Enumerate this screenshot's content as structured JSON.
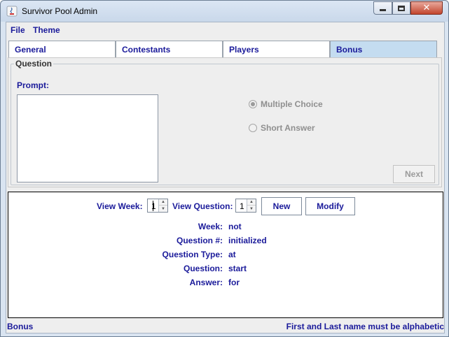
{
  "window": {
    "title": "Survivor Pool Admin"
  },
  "menu": {
    "file": "File",
    "theme": "Theme"
  },
  "tabs": [
    {
      "label": "General"
    },
    {
      "label": "Contestants"
    },
    {
      "label": "Players"
    },
    {
      "label": "Bonus"
    }
  ],
  "question_group": {
    "title": "Question",
    "prompt_label": "Prompt:",
    "radio_multiple_choice": "Multiple Choice",
    "radio_short_answer": "Short Answer",
    "next_button": "Next"
  },
  "viewer": {
    "view_week_label": "View Week:",
    "view_week_value": "1",
    "view_question_label": "View Question:",
    "view_question_value": "1",
    "new_button": "New",
    "modify_button": "Modify",
    "fields": [
      {
        "label": "Week:",
        "value": "not"
      },
      {
        "label": "Question #:",
        "value": "initialized"
      },
      {
        "label": "Question Type:",
        "value": "at"
      },
      {
        "label": "Question:",
        "value": "start"
      },
      {
        "label": "Answer:",
        "value": "for"
      }
    ]
  },
  "status": {
    "left": "Bonus",
    "right": "First and Last name must be alphabetic"
  }
}
